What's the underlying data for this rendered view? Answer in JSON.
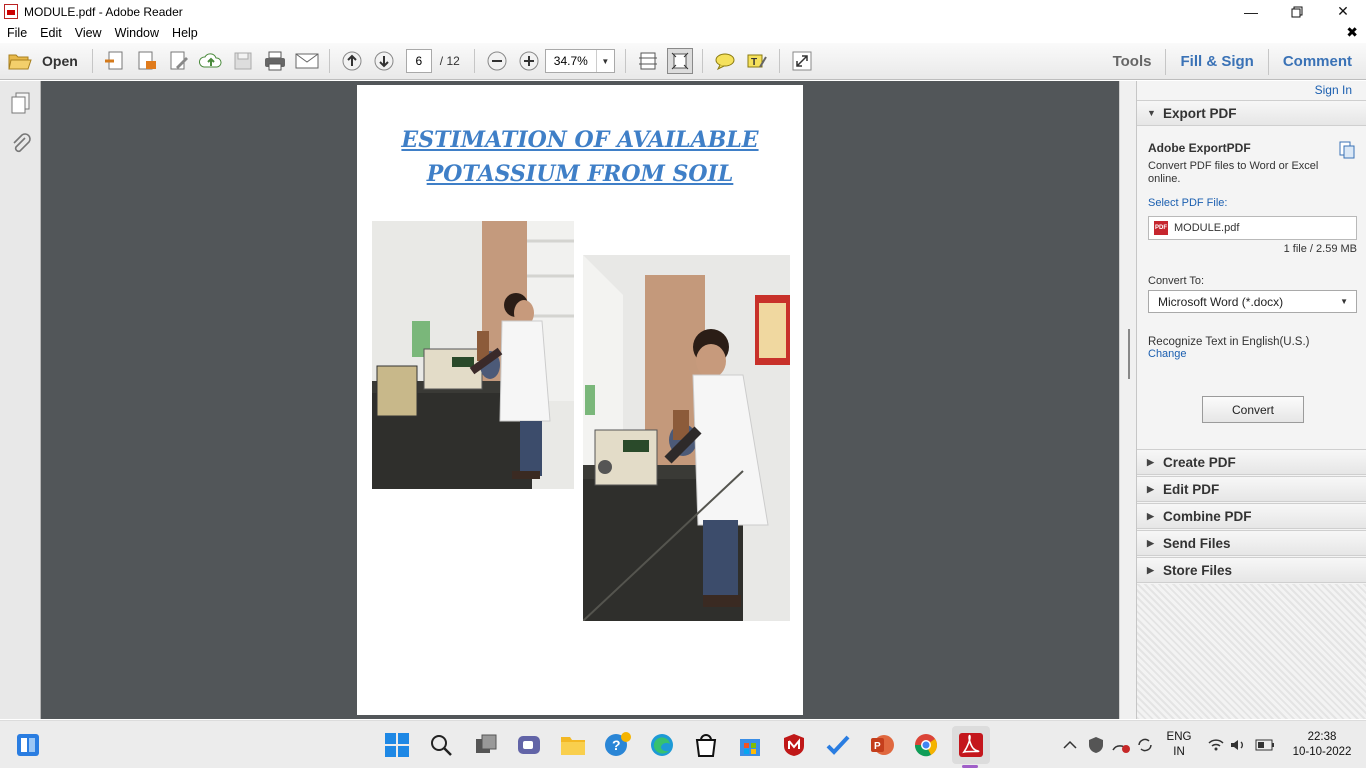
{
  "window": {
    "title": "MODULE.pdf - Adobe Reader"
  },
  "menu": {
    "items": [
      "File",
      "Edit",
      "View",
      "Window",
      "Help"
    ]
  },
  "toolbar": {
    "open_label": "Open",
    "page_current": "6",
    "page_total": "/ 12",
    "zoom": "34.7%",
    "tools_label": "Tools",
    "fill_sign_label": "Fill & Sign",
    "comment_label": "Comment"
  },
  "document": {
    "title_line1": "ESTIMATION OF AVAILABLE",
    "title_line2": "POTASSIUM FROM SOIL"
  },
  "panel": {
    "sign_in": "Sign In",
    "export_header": "Export PDF",
    "service_name": "Adobe ExportPDF",
    "service_desc": "Convert PDF files to Word or Excel online.",
    "select_label": "Select PDF File:",
    "file_name": "MODULE.pdf",
    "file_info": "1 file / 2.59 MB",
    "convert_to_label": "Convert To:",
    "convert_to_value": "Microsoft Word (*.docx)",
    "recognize_text": "Recognize Text in English(U.S.)",
    "change_link": "Change",
    "convert_button": "Convert",
    "sections": [
      "Create PDF",
      "Edit PDF",
      "Combine PDF",
      "Send Files",
      "Store Files"
    ]
  },
  "taskbar": {
    "lang_line1": "ENG",
    "lang_line2": "IN",
    "time": "22:38",
    "date": "10-10-2022"
  },
  "colors": {
    "accent_blue": "#3a72b6",
    "doc_title": "#3f7fc7",
    "viewer_bg": "#525659"
  }
}
